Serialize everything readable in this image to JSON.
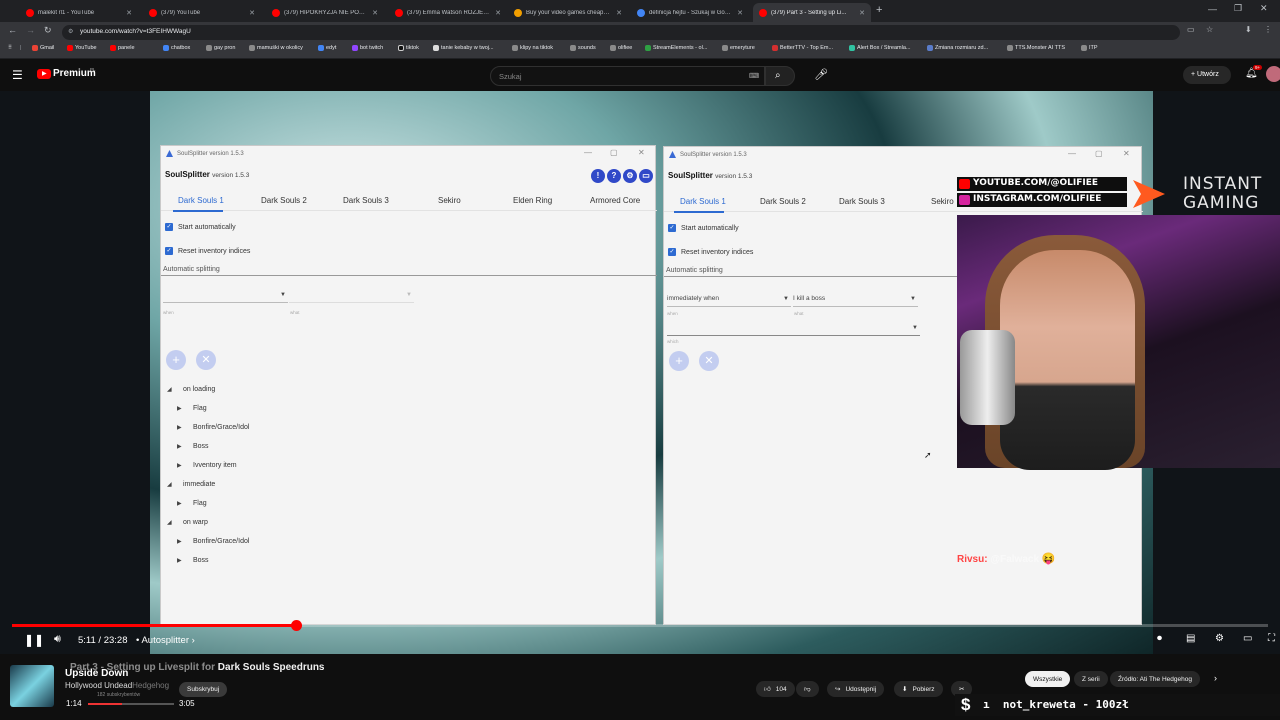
{
  "browser": {
    "tabs": [
      {
        "title": "malekit rl1 - YouTube",
        "color": "#ff0000"
      },
      {
        "title": "(379) YouTube",
        "color": "#ff0000"
      },
      {
        "title": "(379) HIPOKRYZJA NIE POPŁACA...",
        "color": "#ff0000"
      },
      {
        "title": "(379) Emma Watson ROZJECHAŁA...",
        "color": "#ff0000"
      },
      {
        "title": "Buy your video games cheaper...",
        "color": "#f29f00"
      },
      {
        "title": "definicja hejtu - Szukaj w Google",
        "color": "#4285f4"
      },
      {
        "title": "(379) Part 3 - Setting up Li...",
        "color": "#ff0000",
        "active": true
      }
    ],
    "url": "youtube.com/watch?v=t3FEIHWWagU",
    "bookmarks": [
      "Gmail",
      "YouTube",
      "panele",
      "chatbox",
      "gay pron",
      "mamuśki w okolicy",
      "edyt",
      "bot twitch",
      "tiktok",
      "tanie kebaby w twoj...",
      "klipy na tiktok",
      "sounds",
      "olifiee",
      "StreamElements - ol...",
      "emeryture",
      "BetterTTV - Top Em...",
      "Alert Box / Streamla...",
      "Zmiana rozmiaru zd...",
      "TTS.Monster AI TTS",
      "ITP"
    ]
  },
  "youtube": {
    "logo": "Premium",
    "logo_sup": "PL",
    "search_placeholder": "Szukaj",
    "create_label": "Utwórz",
    "notif_count": "9+"
  },
  "left_window": {
    "title": "SoulSplitter version 1.5.3",
    "app_name": "SoulSplitter",
    "app_version": "version 1.5.3",
    "tabs": [
      "Dark Souls 1",
      "Dark Souls 2",
      "Dark Souls 3",
      "Sekiro",
      "Elden Ring",
      "Armored Core"
    ],
    "checks": [
      "Start automatically",
      "Reset inventory indices"
    ],
    "section": "Automatic splitting",
    "sub_when": "when",
    "sub_what": "what",
    "tree": [
      {
        "label": "on loading",
        "level": 0,
        "open": true
      },
      {
        "label": "Flag",
        "level": 1
      },
      {
        "label": "Bonfire/Grace/Idol",
        "level": 1
      },
      {
        "label": "Boss",
        "level": 1
      },
      {
        "label": "Ivventory item",
        "level": 1
      },
      {
        "label": "immediate",
        "level": 0,
        "open": true
      },
      {
        "label": "Flag",
        "level": 1
      },
      {
        "label": "on warp",
        "level": 0,
        "open": true
      },
      {
        "label": "Bonfire/Grace/Idol",
        "level": 1
      },
      {
        "label": "Boss",
        "level": 1
      }
    ]
  },
  "right_window": {
    "title": "SoulSplitter version 1.5.3",
    "app_name": "SoulSplitter",
    "app_version": "version 1.5.3",
    "tabs": [
      "Dark Souls 1",
      "Dark Souls 2",
      "Dark Souls 3",
      "Sekiro"
    ],
    "checks": [
      "Start automatically",
      "Reset inventory indices"
    ],
    "section": "Automatic splitting",
    "when_value": "immediately when",
    "what_value": "I kill a boss",
    "sub_when": "when",
    "sub_what": "what",
    "sub_which": "which"
  },
  "overlay": {
    "youtube_handle": "YOUTUBE.COM/@OLIFIEE",
    "instagram_handle": "INSTAGRAM.COM/OLIFIEE",
    "sponsor_line1": "INSTANT",
    "sponsor_line2": "GAMING",
    "chat_user": "Rivsu:",
    "chat_text": "@Falwack"
  },
  "player": {
    "time": "5:11 / 23:28",
    "chapter": "Autosplitter",
    "progress_fraction": 0.226
  },
  "below": {
    "video_title_prefix": "Part 3 - Setting up Livesplit for",
    "video_title_bold": "Dark Souls Speedruns",
    "song_title": "Upside Down",
    "song_artist": "Hollywood Undead",
    "channel_sub": "Hedgehog",
    "subscribers": "182 subskrybentów",
    "subscribe_label": "Subskrybuj",
    "mini_time_current": "1:14",
    "mini_time_total": "3:05",
    "likes": "104",
    "share_label": "Udostępnij",
    "download_label": "Pobierz",
    "filters": [
      "Wszystkie",
      "Z serii",
      "Źródło: Ati The Hedgehog"
    ],
    "ticker": "not_kreweta - 100zł"
  }
}
